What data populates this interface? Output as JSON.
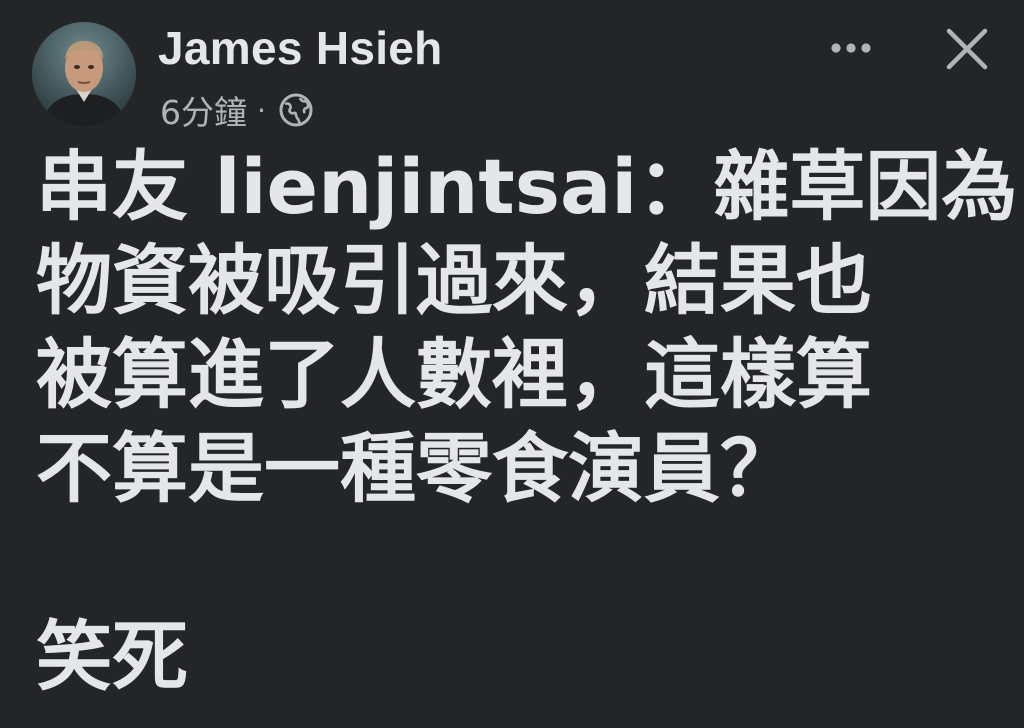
{
  "post": {
    "author": {
      "name": "James Hsieh",
      "avatar_icon": "profile-photo"
    },
    "timestamp": "6分鐘",
    "separator": "·",
    "audience_icon": "globe-icon",
    "header_actions": {
      "more_icon": "more-horizontal-icon",
      "close_icon": "close-icon"
    },
    "body_lines": [
      "串友 lienjintsai：雜草因為",
      "物資被吸引過來，結果也",
      "被算進了人數裡，這樣算",
      "不算是一種零食演員？"
    ],
    "body_last_line": "笑死"
  },
  "colors": {
    "background": "#242526",
    "primary_text": "#e4e6eb",
    "secondary_text": "#b0b3b8"
  }
}
